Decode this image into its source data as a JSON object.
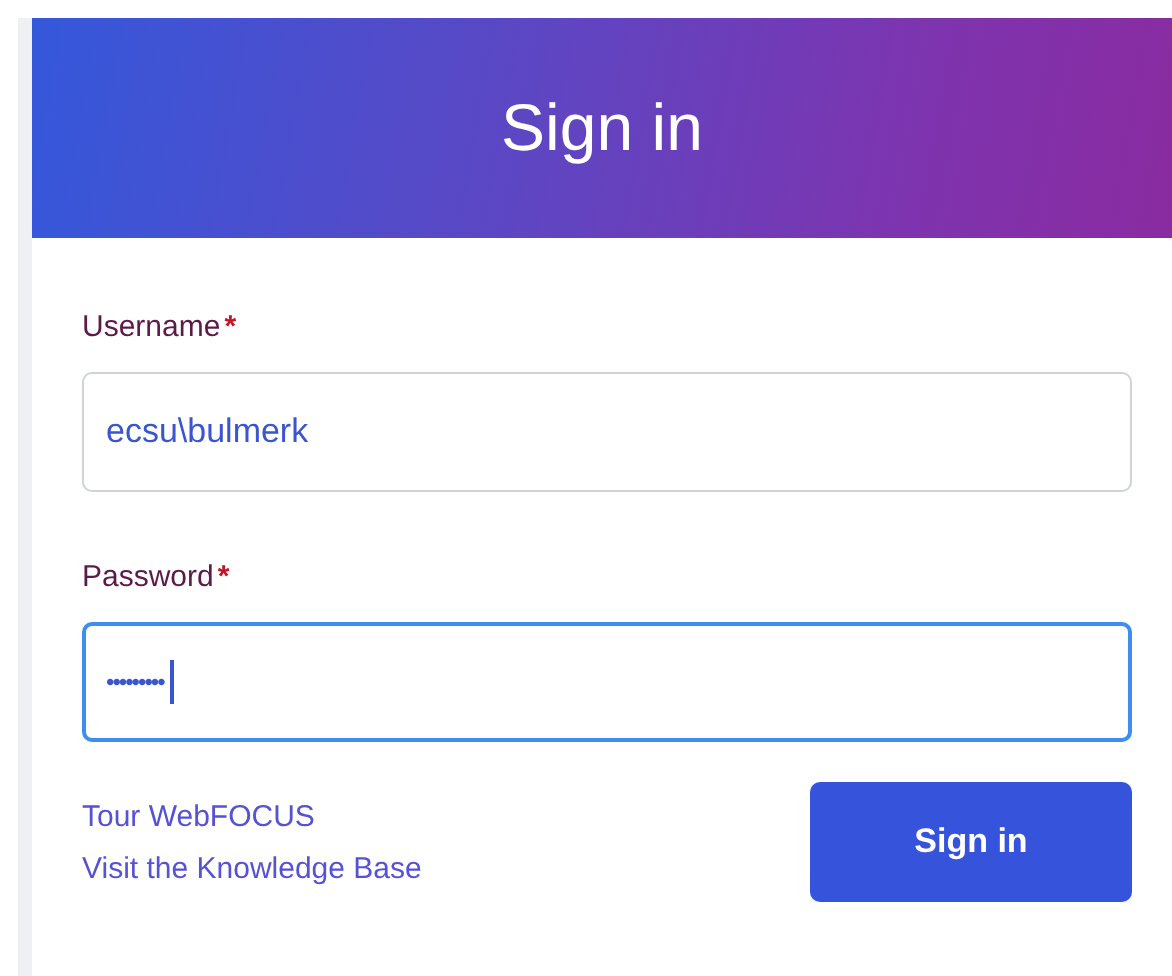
{
  "header": {
    "title": "Sign in"
  },
  "fields": [
    {
      "label": "Username",
      "required_marker": "*",
      "value": "ecsu\\bulmerk",
      "focused": false
    },
    {
      "label": "Password",
      "required_marker": "*",
      "value": "•••••••••",
      "focused": true
    }
  ],
  "links": [
    "Tour WebFOCUS",
    "Visit the Knowledge Base"
  ],
  "submit_button": "Sign in"
}
